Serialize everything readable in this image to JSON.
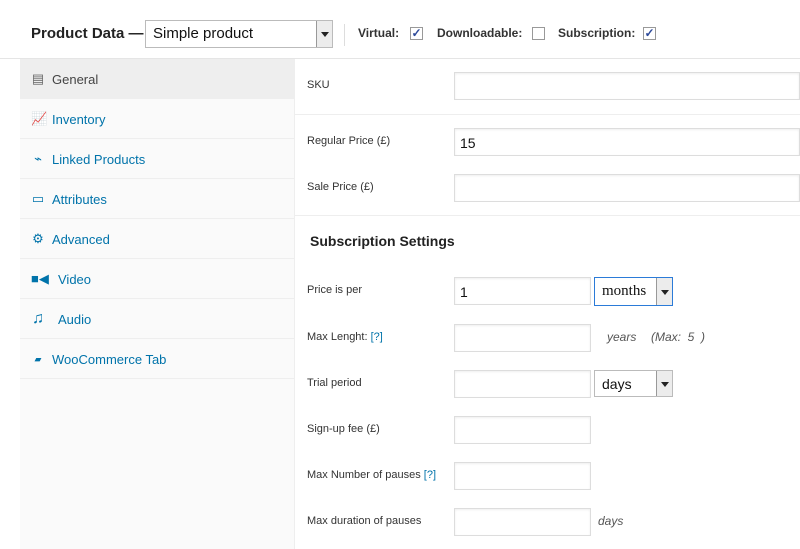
{
  "header": {
    "title": "Product Data —",
    "product_type": "Simple product",
    "options": [
      {
        "label": "Virtual:",
        "checked": true
      },
      {
        "label": "Downloadable:",
        "checked": false
      },
      {
        "label": "Subscription:",
        "checked": true
      }
    ]
  },
  "sidebar": {
    "items": [
      {
        "label": "General",
        "icon": "general-icon",
        "active": true
      },
      {
        "label": "Inventory",
        "icon": "inventory-icon"
      },
      {
        "label": "Linked Products",
        "icon": "link-icon"
      },
      {
        "label": "Attributes",
        "icon": "attributes-icon"
      },
      {
        "label": "Advanced",
        "icon": "gear-icon"
      },
      {
        "label": "Video",
        "icon": "video-icon"
      },
      {
        "label": "Audio",
        "icon": "music-icon"
      },
      {
        "label": "WooCommerce Tab",
        "icon": "woo-icon"
      }
    ]
  },
  "general": {
    "sku_label": "SKU",
    "sku_value": "",
    "regular_price_label": "Regular Price (£)",
    "regular_price_value": "15",
    "sale_price_label": "Sale Price (£)",
    "sale_price_value": ""
  },
  "subscription": {
    "heading": "Subscription Settings",
    "price_per_label": "Price is per",
    "price_per_value": "1",
    "price_per_unit": "months",
    "max_length_label": "Max Lenght:",
    "help": "[?]",
    "max_length_unit": "years",
    "max_length_note": "(Max:  5  )",
    "trial_label": "Trial period",
    "trial_unit": "days",
    "signup_label": "Sign-up fee (£)",
    "max_pauses_label": "Max Number of pauses",
    "max_duration_label": "Max duration of pauses",
    "max_duration_unit": "days"
  },
  "colors": {
    "link": "#0073aa",
    "active_tab_bg": "#eeeeee",
    "sidebar_bg": "#fafafa"
  }
}
